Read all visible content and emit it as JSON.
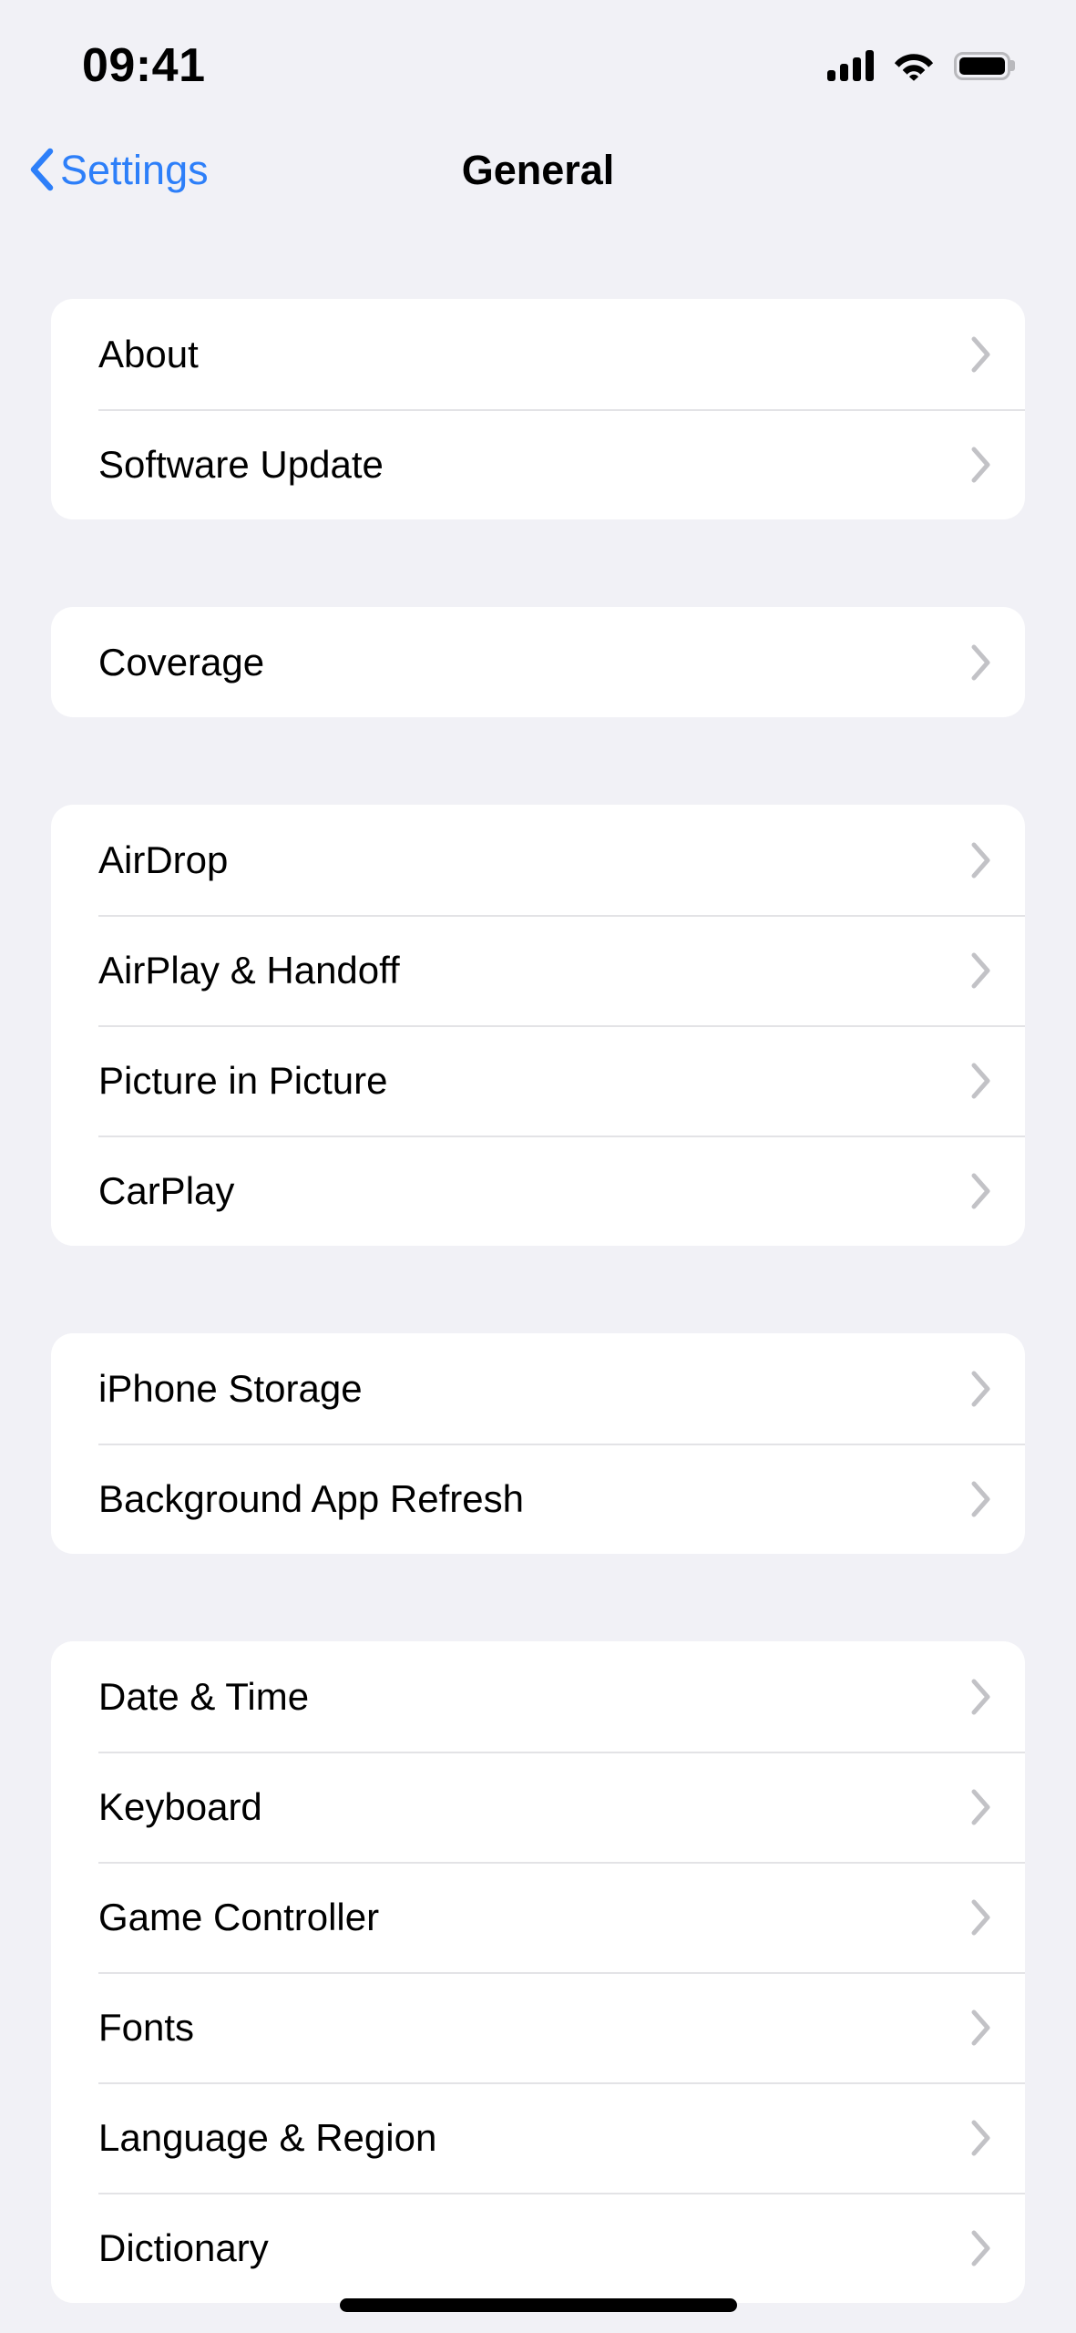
{
  "status_bar": {
    "time": "09:41",
    "cellular_icon": "cellular-signal-icon",
    "cellular_bars": 4,
    "wifi_icon": "wifi-icon",
    "battery_icon": "battery-full-icon",
    "battery_level": "100"
  },
  "nav": {
    "back_icon": "chevron-left-icon",
    "back_label": "Settings",
    "title": "General"
  },
  "accent_color": "#2D7FF9",
  "background_color": "#F1F1F6",
  "card_color": "#FFFFFF",
  "separator_color": "#E3E3E6",
  "chevron_color": "#C2C2C6",
  "disclosure_icon": "chevron-right-icon",
  "groups": [
    {
      "rows": [
        {
          "label": "About"
        },
        {
          "label": "Software Update"
        }
      ]
    },
    {
      "rows": [
        {
          "label": "Coverage"
        }
      ]
    },
    {
      "rows": [
        {
          "label": "AirDrop"
        },
        {
          "label": "AirPlay & Handoff"
        },
        {
          "label": "Picture in Picture"
        },
        {
          "label": "CarPlay"
        }
      ]
    },
    {
      "rows": [
        {
          "label": "iPhone Storage"
        },
        {
          "label": "Background App Refresh"
        }
      ]
    },
    {
      "rows": [
        {
          "label": "Date & Time"
        },
        {
          "label": "Keyboard"
        },
        {
          "label": "Game Controller"
        },
        {
          "label": "Fonts"
        },
        {
          "label": "Language & Region"
        },
        {
          "label": "Dictionary"
        }
      ]
    }
  ],
  "home_indicator": "home-indicator-bar"
}
